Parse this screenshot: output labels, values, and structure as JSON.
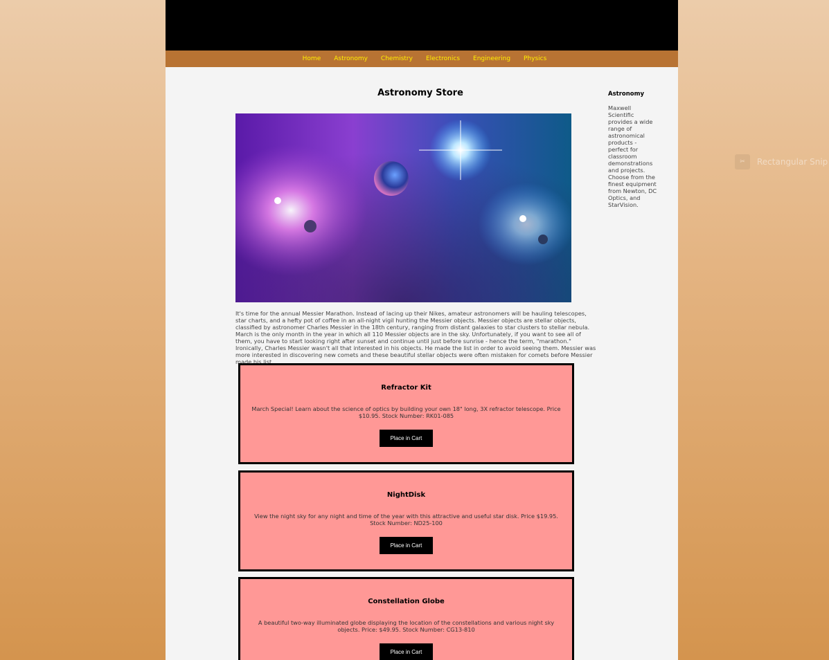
{
  "nav": {
    "items": [
      "Home",
      "Astronomy",
      "Chemistry",
      "Electronics",
      "Engineering",
      "Physics"
    ]
  },
  "main": {
    "title": "Astronomy Store",
    "intro": "It's time for the annual Messier Marathon. Instead of lacing up their Nikes, amateur astronomers will be hauling telescopes, star charts, and a hefty pot of coffee in an all-night vigil hunting the Messier objects. Messier objects are stellar objects, classified by astronomer Charles Messier in the 18th century, ranging from distant galaxies to star clusters to stellar nebula. March is the only month in the year in which all 110 Messier objects are in the sky. Unfortunately, if you want to see all of them, you have to start looking right after sunset and continue until just before sunrise - hence the term, \"marathon.\" Ironically, Charles Messier wasn't all that interested in his objects. He made the list in order to avoid seeing them. Messier was more interested in discovering new comets and these beautiful stellar objects were often mistaken for comets before Messier made his list."
  },
  "sidebar": {
    "heading": "Astronomy",
    "text": "Maxwell Scientific provides a wide range of astronomical products - perfect for classroom demonstrations and projects. Choose from the finest equipment from Newton, DC Optics, and StarVision."
  },
  "products": [
    {
      "name": "Refractor Kit",
      "description": "March Special! Learn about the science of optics by building your own 18\" long, 3X refractor telescope. Price $10.95. Stock Number: RK01-085",
      "button": "Place in Cart"
    },
    {
      "name": "NightDisk",
      "description": "View the night sky for any night and time of the year with this attractive and useful star disk. Price $19.95. Stock Number: ND25-100",
      "button": "Place in Cart"
    },
    {
      "name": "Constellation Globe",
      "description": "A beautiful two-way illuminated globe displaying the location of the constellations and various night sky objects. Price: $49.95. Stock Number: CG13-810",
      "button": "Place in Cart"
    }
  ],
  "overlay": {
    "snip_label": "Rectangular Snip",
    "snip_icon": "scissors-icon"
  },
  "colors": {
    "nav_bg": "#b87333",
    "nav_link": "#ffee00",
    "product_bg": "#ff9896",
    "button_bg": "#000000"
  }
}
